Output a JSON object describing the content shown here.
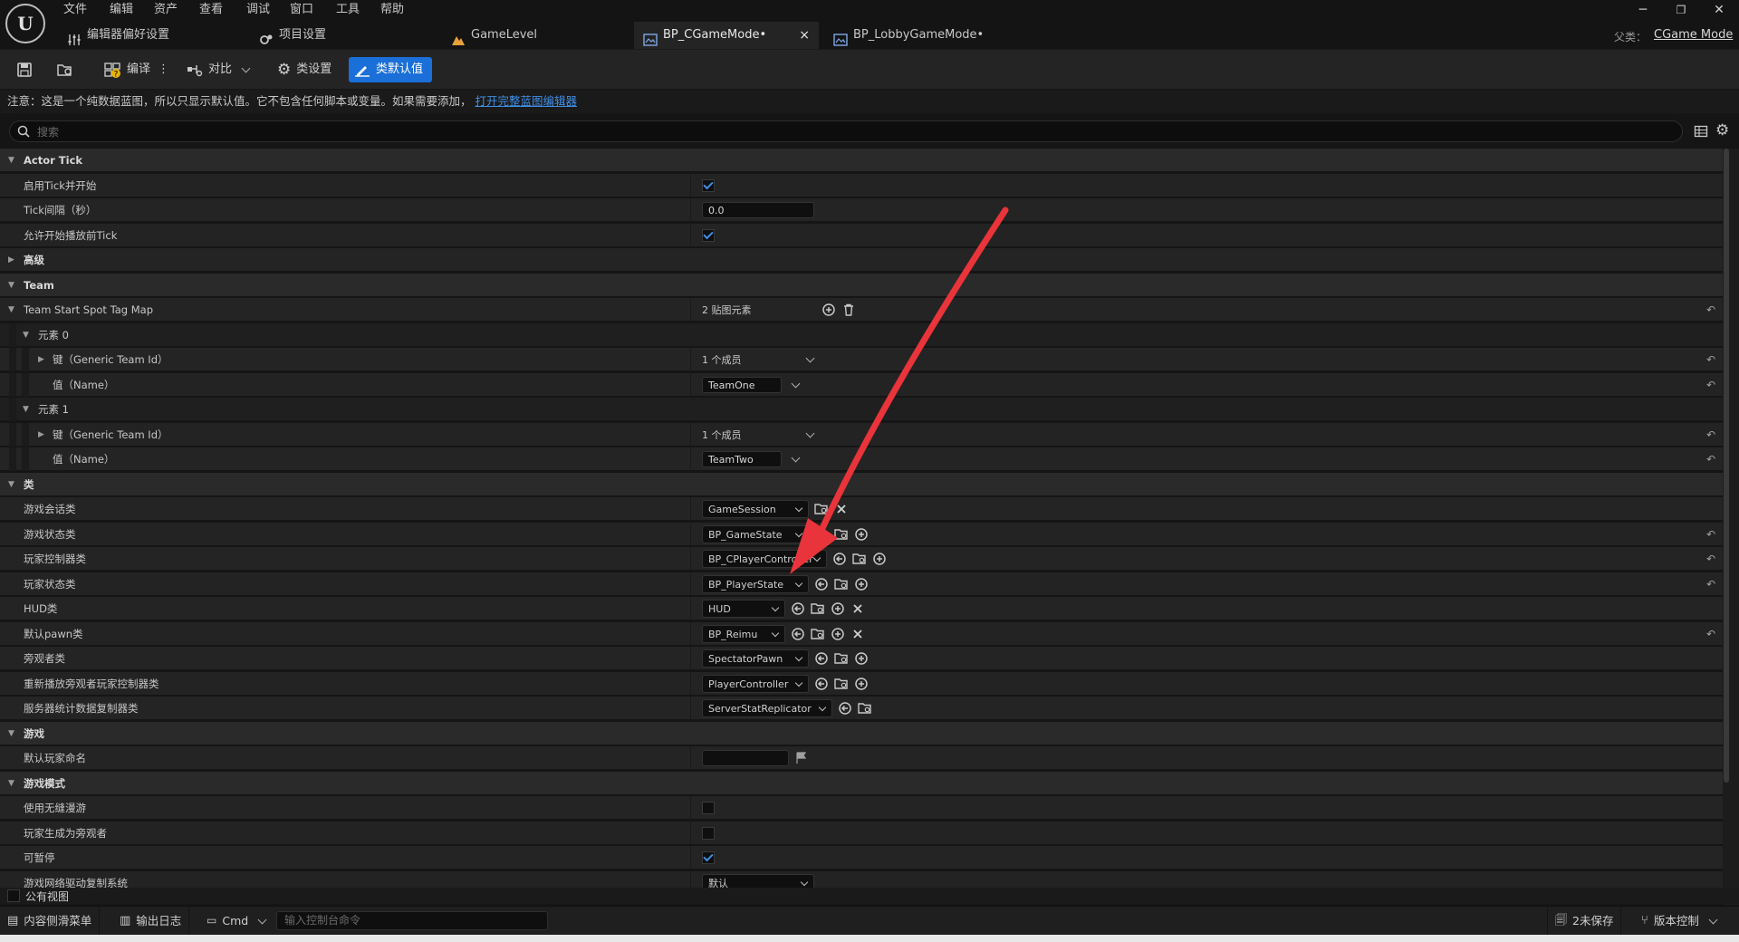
{
  "menu": [
    "文件",
    "编辑",
    "资产",
    "查看",
    "调试",
    "窗口",
    "工具",
    "帮助"
  ],
  "tabs": [
    {
      "label": "编辑器偏好设置"
    },
    {
      "label": "项目设置"
    },
    {
      "label": "GameLevel"
    },
    {
      "label": "BP_CGameMode•",
      "close": "×"
    },
    {
      "label": "BP_LobbyGameMode•"
    }
  ],
  "parent": {
    "label": "父类：",
    "value": "CGame Mode"
  },
  "toolbar": {
    "compile": "编译",
    "diff": "对比",
    "class_settings": "类设置",
    "class_defaults": "类默认值"
  },
  "notice": {
    "text": "注意：这是一个纯数据蓝图，所以只显示默认值。它不包含任何脚本或变量。如果需要添加，",
    "link": "打开完整蓝图编辑器"
  },
  "search": {
    "placeholder": "搜索"
  },
  "rows": [
    {
      "type": "cat",
      "label": "Actor Tick",
      "indent": 0,
      "expanded": true
    },
    {
      "type": "prop",
      "label": "启用Tick并开始",
      "indent": 1,
      "value": {
        "kind": "check",
        "on": true
      }
    },
    {
      "type": "prop",
      "label": "Tick间隔（秒）",
      "indent": 1,
      "value": {
        "kind": "text",
        "text": "0.0"
      }
    },
    {
      "type": "prop",
      "label": "允许开始播放前Tick",
      "indent": 1,
      "value": {
        "kind": "check",
        "on": true
      }
    },
    {
      "type": "cat2",
      "label": "高级",
      "indent": 0,
      "expanded": false
    },
    {
      "type": "cat",
      "label": "Team",
      "indent": 0,
      "expanded": true
    },
    {
      "type": "prop",
      "label": "Team Start Spot Tag Map",
      "indent": 0,
      "expander": "down",
      "value": {
        "kind": "map",
        "text": "2 贴图元素"
      },
      "reset": true
    },
    {
      "type": "sub",
      "label": "元素 0",
      "indent": 1,
      "expander": "down"
    },
    {
      "type": "prop",
      "label": "键（Generic Team Id）",
      "indent": 2,
      "expander": "right",
      "value": {
        "kind": "members",
        "text": "1 个成员"
      },
      "reset": true
    },
    {
      "type": "prop",
      "label": "值（Name）",
      "indent": 2,
      "value": {
        "kind": "namecombo",
        "text": "TeamOne"
      },
      "reset": true
    },
    {
      "type": "sub",
      "label": "元素 1",
      "indent": 1,
      "expander": "down"
    },
    {
      "type": "prop",
      "label": "键（Generic Team Id）",
      "indent": 2,
      "expander": "right",
      "value": {
        "kind": "members",
        "text": "1 个成员"
      },
      "reset": true
    },
    {
      "type": "prop",
      "label": "值（Name）",
      "indent": 2,
      "value": {
        "kind": "namecombo",
        "text": "TeamTwo"
      },
      "reset": true
    },
    {
      "type": "cat",
      "label": "类",
      "indent": 0,
      "expanded": true
    },
    {
      "type": "prop",
      "label": "游戏会话类",
      "indent": 1,
      "value": {
        "kind": "class",
        "text": "GameSession",
        "w": 118,
        "icons": [
          "browse",
          "clear"
        ]
      }
    },
    {
      "type": "prop",
      "label": "游戏状态类",
      "indent": 1,
      "value": {
        "kind": "class",
        "text": "BP_GameState",
        "w": 118,
        "icons": [
          "use",
          "browse",
          "add"
        ]
      },
      "reset": true
    },
    {
      "type": "prop",
      "label": "玩家控制器类",
      "indent": 1,
      "value": {
        "kind": "class",
        "text": "BP_CPlayerController",
        "w": 138,
        "icons": [
          "use",
          "browse",
          "add"
        ]
      },
      "reset": true
    },
    {
      "type": "prop",
      "label": "玩家状态类",
      "indent": 1,
      "value": {
        "kind": "class",
        "text": "BP_PlayerState",
        "w": 118,
        "icons": [
          "use",
          "browse",
          "add"
        ]
      },
      "reset": true
    },
    {
      "type": "prop",
      "label": "HUD类",
      "indent": 1,
      "value": {
        "kind": "class",
        "text": "HUD",
        "w": 92,
        "icons": [
          "use",
          "browse",
          "add",
          "clear"
        ]
      }
    },
    {
      "type": "prop",
      "label": "默认pawn类",
      "indent": 1,
      "value": {
        "kind": "class",
        "text": "BP_Reimu",
        "w": 92,
        "icons": [
          "use",
          "browse",
          "add",
          "clear"
        ]
      },
      "reset": true
    },
    {
      "type": "prop",
      "label": "旁观者类",
      "indent": 1,
      "value": {
        "kind": "class",
        "text": "SpectatorPawn",
        "w": 118,
        "icons": [
          "use",
          "browse",
          "add"
        ]
      }
    },
    {
      "type": "prop",
      "label": "重新播放旁观者玩家控制器类",
      "indent": 1,
      "value": {
        "kind": "class",
        "text": "PlayerController",
        "w": 118,
        "icons": [
          "use",
          "browse",
          "add"
        ]
      }
    },
    {
      "type": "prop",
      "label": "服务器统计数据复制器类",
      "indent": 1,
      "value": {
        "kind": "class",
        "text": "ServerStatReplicator",
        "w": 144,
        "icons": [
          "use",
          "browse"
        ]
      }
    },
    {
      "type": "cat",
      "label": "游戏",
      "indent": 0,
      "expanded": true
    },
    {
      "type": "prop",
      "label": "默认玩家命名",
      "indent": 1,
      "value": {
        "kind": "textflag",
        "text": ""
      }
    },
    {
      "type": "cat",
      "label": "游戏模式",
      "indent": 0,
      "expanded": true
    },
    {
      "type": "prop",
      "label": "使用无缝漫游",
      "indent": 1,
      "value": {
        "kind": "check",
        "on": false
      }
    },
    {
      "type": "prop",
      "label": "玩家生成为旁观者",
      "indent": 1,
      "value": {
        "kind": "check",
        "on": false
      }
    },
    {
      "type": "prop",
      "label": "可暂停",
      "indent": 1,
      "value": {
        "kind": "check",
        "on": true
      }
    },
    {
      "type": "prop",
      "label": "游戏网络驱动复制系统",
      "indent": 1,
      "value": {
        "kind": "combo",
        "text": "默认",
        "w": 124
      }
    }
  ],
  "public_view": "公有视图",
  "statusbar": {
    "content_drawer": "内容侧滑菜单",
    "output_log": "输出日志",
    "cmd": "Cmd",
    "cmd_placeholder": "输入控制台命令",
    "unsaved": "2未保存",
    "source_control": "版本控制"
  },
  "colors": {
    "accent": "#1a6fd8",
    "link": "#3f8fe8",
    "arrow": "#e8343a"
  }
}
